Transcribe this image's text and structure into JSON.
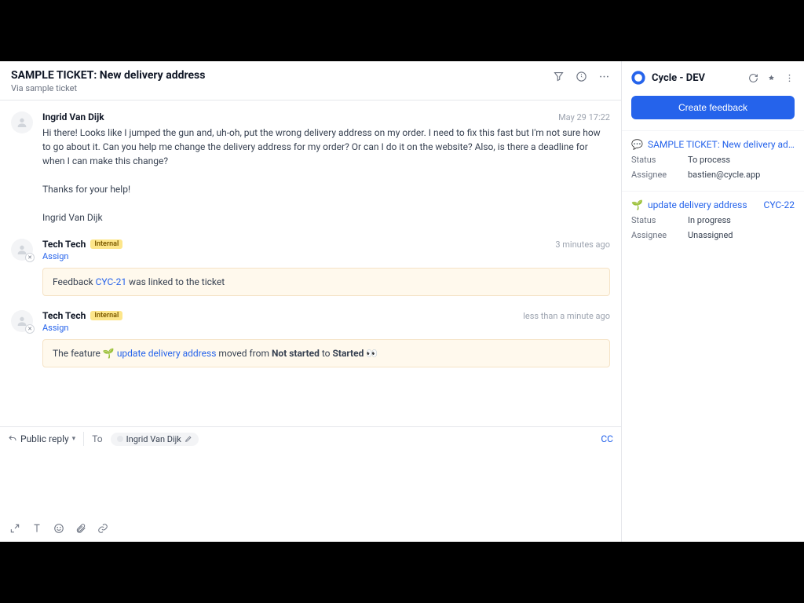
{
  "header": {
    "title": "SAMPLE TICKET: New delivery address",
    "subtitle": "Via sample ticket"
  },
  "messages": [
    {
      "author": "Ingrid Van Dijk",
      "timestamp": "May 29 17:22",
      "body": "Hi there! Looks like I jumped the gun and, uh-oh, put the wrong delivery address on my order. I need to fix this fast but I'm not sure how to go about it. Can you help me change the delivery address for my order? Or can I do it on the website? Also, is there a deadline for when I can make this change?\n\nThanks for your help!\n\nIngrid Van Dijk"
    },
    {
      "author": "Tech Tech",
      "internal": "Internal",
      "timestamp": "3 minutes ago",
      "assign": "Assign",
      "note": {
        "prefix": "Feedback ",
        "link": "CYC-21",
        "suffix": " was linked to the ticket"
      }
    },
    {
      "author": "Tech Tech",
      "internal": "Internal",
      "timestamp": "less than a minute ago",
      "assign": "Assign",
      "feature_note": {
        "prefix": "The feature ",
        "icon": "🌱",
        "link": "update delivery address",
        "mid": " moved from ",
        "from": "Not started",
        "to_word": " to ",
        "to": "Started",
        "eyes": " 👀"
      }
    }
  ],
  "composer": {
    "replyType": "Public reply",
    "toLabel": "To",
    "recipient": "Ingrid Van Dijk",
    "cc": "CC"
  },
  "sidebar": {
    "appName": "Cycle - DEV",
    "createBtn": "Create feedback",
    "items": [
      {
        "icon": "💬",
        "title": "SAMPLE TICKET: New delivery address",
        "fields": [
          {
            "label": "Status",
            "value": "To process"
          },
          {
            "label": "Assignee",
            "value": "bastien@cycle.app"
          }
        ]
      },
      {
        "icon": "🌱",
        "title": "update delivery address",
        "key": "CYC-22",
        "fields": [
          {
            "label": "Status",
            "value": "In progress"
          },
          {
            "label": "Assignee",
            "value": "Unassigned"
          }
        ]
      }
    ]
  }
}
